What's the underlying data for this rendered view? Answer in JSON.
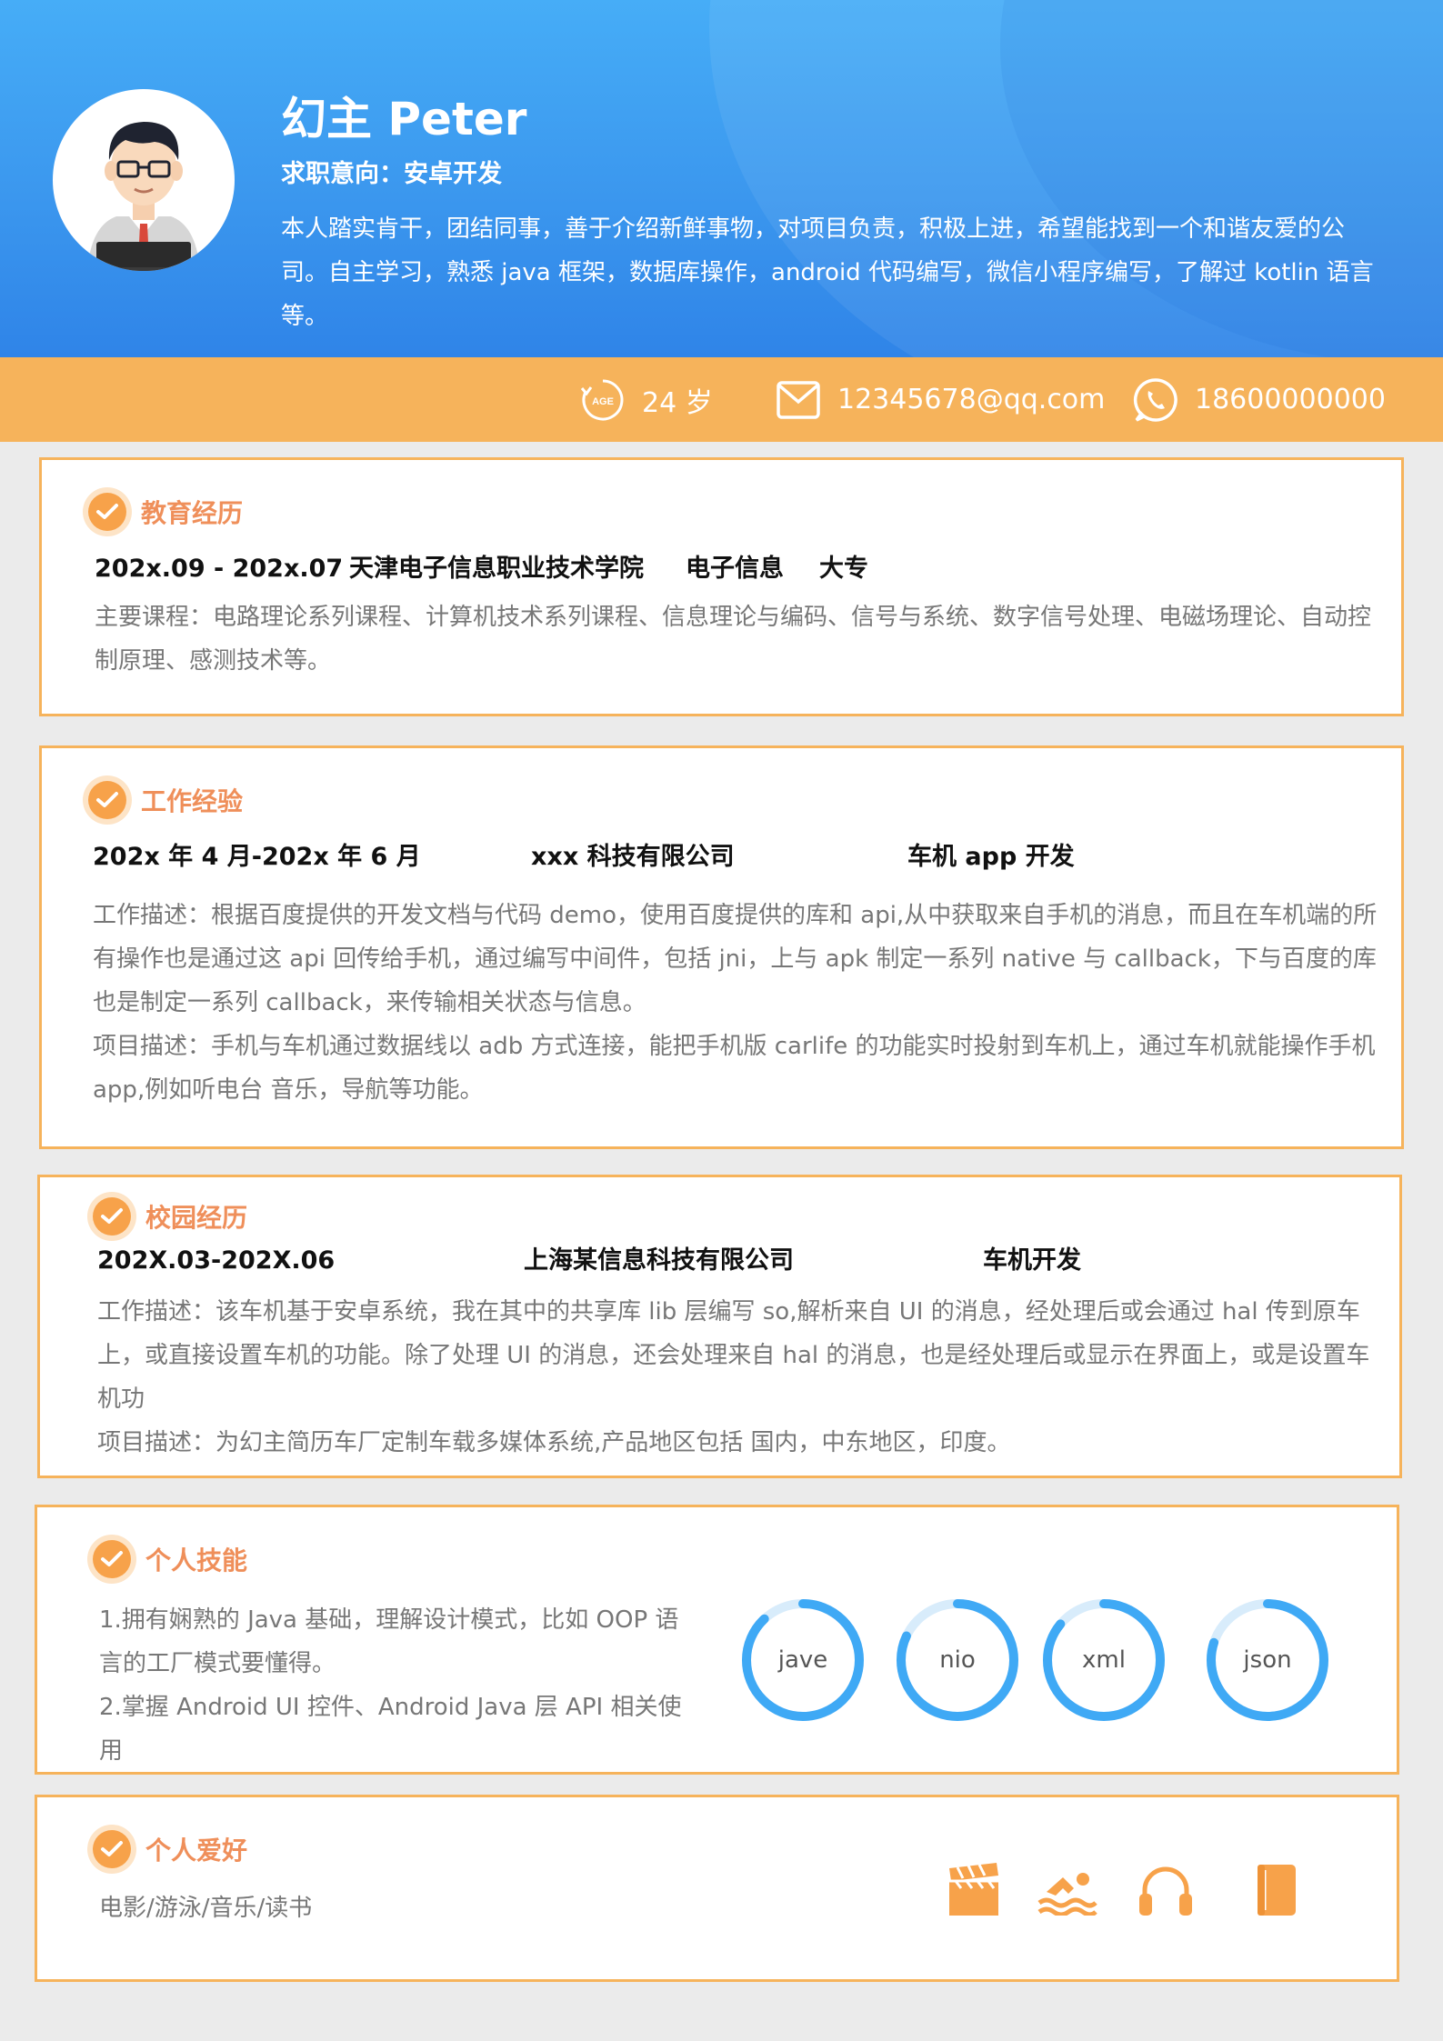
{
  "header": {
    "name": "幻主  Peter",
    "intention": "求职意向：安卓开发",
    "intro": "本人踏实肯干，团结同事，善于介绍新鲜事物，对项目负责，积极上进，希望能找到一个和谐友爱的公司。自主学习，熟悉 java 框架，数据库操作，android 代码编写，微信小程序编写，了解过 kotlin 语言等。"
  },
  "contact": {
    "age_badge": "AGE",
    "age": "24 岁",
    "email": "12345678@qq.com",
    "phone": "18600000000"
  },
  "education": {
    "title": "教育经历",
    "period": "202x.09 - 202x.07",
    "school": "天津电子信息职业技术学院",
    "major": "电子信息",
    "degree": "大专",
    "courses": "主要课程：电路理论系列课程、计算机技术系列课程、信息理论与编码、信号与系统、数字信号处理、电磁场理论、自动控制原理、感测技术等。"
  },
  "work": {
    "title": "工作经验",
    "period": "202x 年 4 月-202x 年 6 月",
    "company": "xxx 科技有限公司",
    "role": "车机 app 开发",
    "desc1": "工作描述：根据百度提供的开发文档与代码 demo，使用百度提供的库和 api,从中获取来自手机的消息，而且在车机端的所有操作也是通过这 api 回传给手机，通过编写中间件，包括 jni，上与 apk 制定一系列 native 与 callback，下与百度的库也是制定一系列 callback，来传输相关状态与信息。",
    "desc2": "项目描述：手机与车机通过数据线以 adb 方式连接，能把手机版 carlife 的功能实时投射到车机上，通过车机就能操作手机 app,例如听电台 音乐，导航等功能。"
  },
  "campus": {
    "title": "校园经历",
    "period": "202X.03-202X.06",
    "company": "上海某信息科技有限公司",
    "role": "车机开发",
    "desc1": "工作描述：该车机基于安卓系统，我在其中的共享库 lib 层编写 so,解析来自 UI 的消息，经处理后或会通过 hal 传到原车上，或直接设置车机的功能。除了处理 UI 的消息，还会处理来自 hal 的消息，也是经处理后或显示在界面上，或是设置车机功",
    "desc2": "项目描述：为幻主简历车厂定制车载多媒体系统,产品地区包括 国内，中东地区，印度。"
  },
  "skills": {
    "title": "个人技能",
    "item1": "1.拥有娴熟的 Java 基础，理解设计模式，比如 OOP 语言的工厂模式要懂得。",
    "item2": "2.掌握 Android UI 控件、Android Java 层 API 相关使用",
    "rings": [
      {
        "label": "jave",
        "level": 0.88
      },
      {
        "label": "nio",
        "level": 0.82
      },
      {
        "label": "xml",
        "level": 0.86
      },
      {
        "label": "json",
        "level": 0.8
      }
    ]
  },
  "hobbies": {
    "title": "个人爱好",
    "text": "电影/游泳/音乐/读书",
    "icons": [
      "movie-icon",
      "swimming-icon",
      "headphones-icon",
      "book-icon"
    ]
  },
  "colors": {
    "primary_blue": "#3b97ee",
    "accent_orange": "#f6b35b",
    "title_orange": "#ef8f5a",
    "ring_blue": "#3fa9f5",
    "ring_track": "#d8ecfb"
  }
}
